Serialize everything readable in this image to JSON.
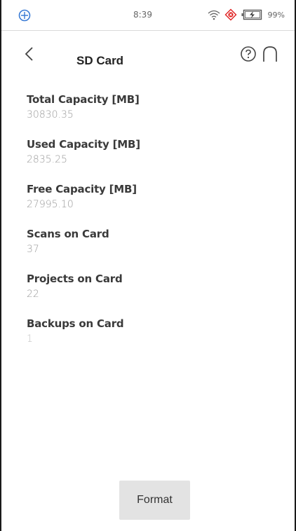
{
  "status_bar": {
    "time": "8:39",
    "battery": "99%",
    "icons": [
      "app-logo-icon",
      "wifi-icon",
      "alert-icon",
      "battery-charging-icon"
    ]
  },
  "app_bar": {
    "title": "SD Card",
    "icons": [
      "back-chevron-icon",
      "help-icon",
      "home-icon"
    ]
  },
  "info": [
    {
      "label": "Total Capacity [MB]",
      "value": "30830.35"
    },
    {
      "label": "Used Capacity [MB]",
      "value": "2835.25"
    },
    {
      "label": "Free Capacity [MB]",
      "value": "27995.10"
    },
    {
      "label": "Scans on Card",
      "value": "37"
    },
    {
      "label": "Projects on Card",
      "value": "22"
    },
    {
      "label": "Backups on Card",
      "value": "1"
    }
  ],
  "actions": {
    "format_label": "Format"
  },
  "colors": {
    "accent_blue": "#3a7bd5",
    "alert_red": "#e02020",
    "label_text": "#3a3a3a",
    "value_text": "#9a9a9a",
    "button_bg": "#e3e3e3"
  }
}
